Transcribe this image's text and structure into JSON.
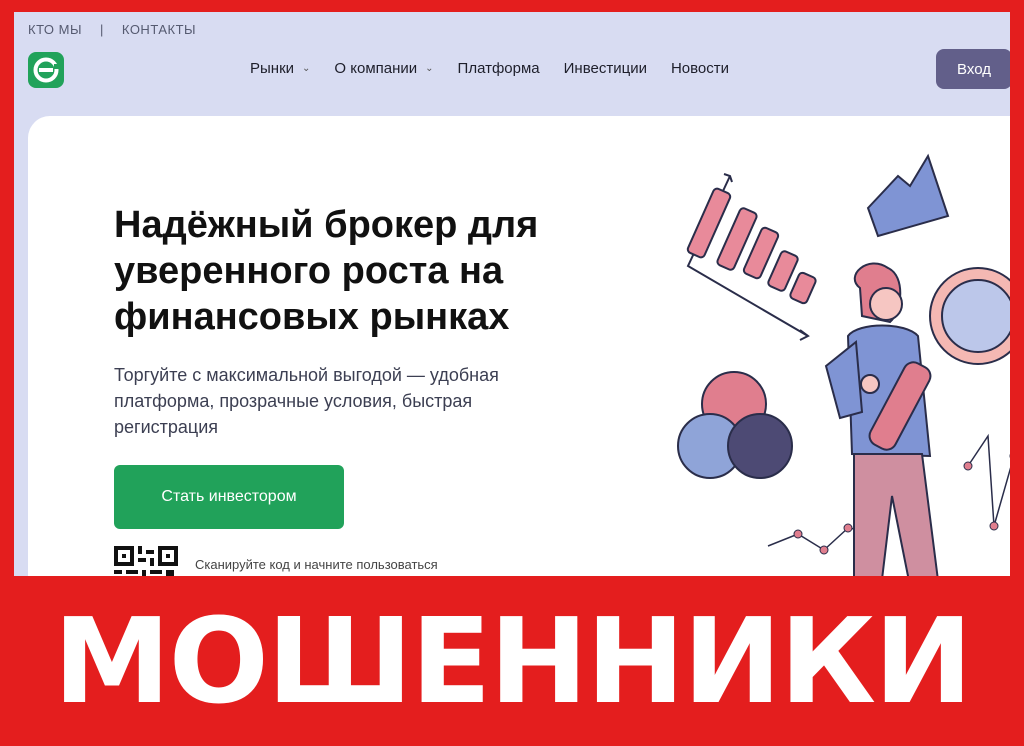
{
  "topbar": {
    "about": "КТО МЫ",
    "separator": "|",
    "contacts": "КОНТАКТЫ"
  },
  "nav": {
    "items": [
      {
        "label": "Рынки",
        "dropdown": true
      },
      {
        "label": "О компании",
        "dropdown": true
      },
      {
        "label": "Платформа",
        "dropdown": false
      },
      {
        "label": "Инвестиции",
        "dropdown": false
      },
      {
        "label": "Новости",
        "dropdown": false
      }
    ],
    "login_label": "Вход"
  },
  "hero": {
    "headline": "Надёжный брокер для уверенного роста на финансовых рынках",
    "subtitle": "Торгуйте с максимальной выгодой — удобная платформа, прозрачные условия, быстрая регистрация",
    "cta_label": "Стать инвестором",
    "qr_caption": "Сканируйте код и начните пользоваться"
  },
  "banner": {
    "text": "МОШЕННИКИ"
  },
  "colors": {
    "brand_green": "#21a25a",
    "login_purple": "#625f8a",
    "header_bg": "#d8dcf2",
    "warning_red": "#e41e1e"
  },
  "icons": {
    "logo": "brand-logo-icon",
    "chevron": "chevron-down-icon"
  }
}
